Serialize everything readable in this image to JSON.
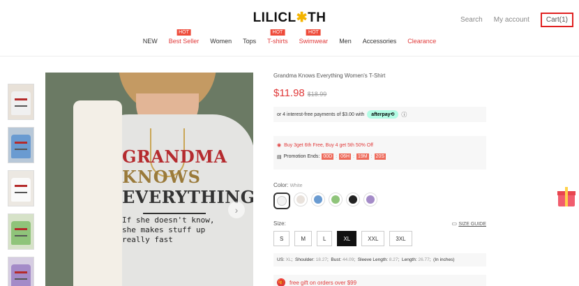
{
  "header": {
    "logo_prefix": "LILICL",
    "logo_sun": "✱",
    "logo_suffix": "TH",
    "search": "Search",
    "account": "My account",
    "cart": "Cart(1)"
  },
  "nav": [
    {
      "label": "NEW",
      "badge": "",
      "red": false
    },
    {
      "label": "Best Seller",
      "badge": "HOT",
      "red": true
    },
    {
      "label": "Women",
      "badge": "",
      "red": false
    },
    {
      "label": "Tops",
      "badge": "",
      "red": false
    },
    {
      "label": "T-shirts",
      "badge": "HOT",
      "red": true
    },
    {
      "label": "Swimwear",
      "badge": "HOT",
      "red": true
    },
    {
      "label": "Men",
      "badge": "",
      "red": false
    },
    {
      "label": "Accessories",
      "badge": "",
      "red": false
    },
    {
      "label": "Clearance",
      "badge": "",
      "red": true
    }
  ],
  "image": {
    "print_line1": "GRANDMA",
    "print_line2": "KNOWS",
    "print_line3": "EVERYTHING",
    "print_small1": "If she doesn't know,",
    "print_small2": "she makes stuff up",
    "print_small3": "really fast"
  },
  "product": {
    "title": "Grandma Knows Everything Women's T-Shirt",
    "price": "$11.98",
    "old_price": "$18.99",
    "pay_text": "or 4 interest-free payments of $3.00 with",
    "afterpay": "afterpay⟲",
    "promo": "Buy 3get 6th Free, Buy 4 get 5th 50% Off",
    "promo_ends": "Promotion Ends:",
    "countdown": [
      "00D",
      "06H",
      "19M",
      "20S"
    ],
    "color_label": "Color:",
    "color_value": "White",
    "size_label": "Size:",
    "size_guide": "SIZE GUIDE",
    "sizes": [
      "S",
      "M",
      "L",
      "XL",
      "XXL",
      "3XL"
    ],
    "selected_size": "XL",
    "measure": {
      "us_label": "US:",
      "us": "XL",
      "shoulder_label": "Shoulder:",
      "shoulder": "18.27",
      "bust_label": "Bust:",
      "bust": "44.09",
      "sleeve_label": "Sleeve Length:",
      "sleeve": "8.27",
      "length_label": "Length:",
      "length": "26.77",
      "unit": "(In inches)"
    },
    "gift": "free gift on orders over $99"
  },
  "colors": {
    "accent": "#e03a3a",
    "swatches": [
      "#f2f2f2",
      "#f7f7f7",
      "#6a9bd1",
      "#8fc47a",
      "#222222",
      "#a48bc8"
    ]
  }
}
